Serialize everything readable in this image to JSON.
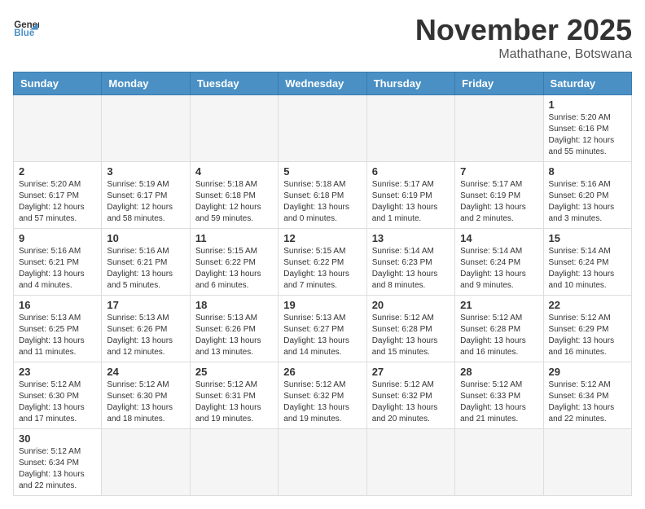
{
  "header": {
    "logo_general": "General",
    "logo_blue": "Blue",
    "month_title": "November 2025",
    "location": "Mathathane, Botswana"
  },
  "days_of_week": [
    "Sunday",
    "Monday",
    "Tuesday",
    "Wednesday",
    "Thursday",
    "Friday",
    "Saturday"
  ],
  "weeks": [
    [
      {
        "day": "",
        "info": ""
      },
      {
        "day": "",
        "info": ""
      },
      {
        "day": "",
        "info": ""
      },
      {
        "day": "",
        "info": ""
      },
      {
        "day": "",
        "info": ""
      },
      {
        "day": "",
        "info": ""
      },
      {
        "day": "1",
        "info": "Sunrise: 5:20 AM\nSunset: 6:16 PM\nDaylight: 12 hours and 55 minutes."
      }
    ],
    [
      {
        "day": "2",
        "info": "Sunrise: 5:20 AM\nSunset: 6:17 PM\nDaylight: 12 hours and 57 minutes."
      },
      {
        "day": "3",
        "info": "Sunrise: 5:19 AM\nSunset: 6:17 PM\nDaylight: 12 hours and 58 minutes."
      },
      {
        "day": "4",
        "info": "Sunrise: 5:18 AM\nSunset: 6:18 PM\nDaylight: 12 hours and 59 minutes."
      },
      {
        "day": "5",
        "info": "Sunrise: 5:18 AM\nSunset: 6:18 PM\nDaylight: 13 hours and 0 minutes."
      },
      {
        "day": "6",
        "info": "Sunrise: 5:17 AM\nSunset: 6:19 PM\nDaylight: 13 hours and 1 minute."
      },
      {
        "day": "7",
        "info": "Sunrise: 5:17 AM\nSunset: 6:19 PM\nDaylight: 13 hours and 2 minutes."
      },
      {
        "day": "8",
        "info": "Sunrise: 5:16 AM\nSunset: 6:20 PM\nDaylight: 13 hours and 3 minutes."
      }
    ],
    [
      {
        "day": "9",
        "info": "Sunrise: 5:16 AM\nSunset: 6:21 PM\nDaylight: 13 hours and 4 minutes."
      },
      {
        "day": "10",
        "info": "Sunrise: 5:16 AM\nSunset: 6:21 PM\nDaylight: 13 hours and 5 minutes."
      },
      {
        "day": "11",
        "info": "Sunrise: 5:15 AM\nSunset: 6:22 PM\nDaylight: 13 hours and 6 minutes."
      },
      {
        "day": "12",
        "info": "Sunrise: 5:15 AM\nSunset: 6:22 PM\nDaylight: 13 hours and 7 minutes."
      },
      {
        "day": "13",
        "info": "Sunrise: 5:14 AM\nSunset: 6:23 PM\nDaylight: 13 hours and 8 minutes."
      },
      {
        "day": "14",
        "info": "Sunrise: 5:14 AM\nSunset: 6:24 PM\nDaylight: 13 hours and 9 minutes."
      },
      {
        "day": "15",
        "info": "Sunrise: 5:14 AM\nSunset: 6:24 PM\nDaylight: 13 hours and 10 minutes."
      }
    ],
    [
      {
        "day": "16",
        "info": "Sunrise: 5:13 AM\nSunset: 6:25 PM\nDaylight: 13 hours and 11 minutes."
      },
      {
        "day": "17",
        "info": "Sunrise: 5:13 AM\nSunset: 6:26 PM\nDaylight: 13 hours and 12 minutes."
      },
      {
        "day": "18",
        "info": "Sunrise: 5:13 AM\nSunset: 6:26 PM\nDaylight: 13 hours and 13 minutes."
      },
      {
        "day": "19",
        "info": "Sunrise: 5:13 AM\nSunset: 6:27 PM\nDaylight: 13 hours and 14 minutes."
      },
      {
        "day": "20",
        "info": "Sunrise: 5:12 AM\nSunset: 6:28 PM\nDaylight: 13 hours and 15 minutes."
      },
      {
        "day": "21",
        "info": "Sunrise: 5:12 AM\nSunset: 6:28 PM\nDaylight: 13 hours and 16 minutes."
      },
      {
        "day": "22",
        "info": "Sunrise: 5:12 AM\nSunset: 6:29 PM\nDaylight: 13 hours and 16 minutes."
      }
    ],
    [
      {
        "day": "23",
        "info": "Sunrise: 5:12 AM\nSunset: 6:30 PM\nDaylight: 13 hours and 17 minutes."
      },
      {
        "day": "24",
        "info": "Sunrise: 5:12 AM\nSunset: 6:30 PM\nDaylight: 13 hours and 18 minutes."
      },
      {
        "day": "25",
        "info": "Sunrise: 5:12 AM\nSunset: 6:31 PM\nDaylight: 13 hours and 19 minutes."
      },
      {
        "day": "26",
        "info": "Sunrise: 5:12 AM\nSunset: 6:32 PM\nDaylight: 13 hours and 19 minutes."
      },
      {
        "day": "27",
        "info": "Sunrise: 5:12 AM\nSunset: 6:32 PM\nDaylight: 13 hours and 20 minutes."
      },
      {
        "day": "28",
        "info": "Sunrise: 5:12 AM\nSunset: 6:33 PM\nDaylight: 13 hours and 21 minutes."
      },
      {
        "day": "29",
        "info": "Sunrise: 5:12 AM\nSunset: 6:34 PM\nDaylight: 13 hours and 22 minutes."
      }
    ],
    [
      {
        "day": "30",
        "info": "Sunrise: 5:12 AM\nSunset: 6:34 PM\nDaylight: 13 hours and 22 minutes."
      },
      {
        "day": "",
        "info": ""
      },
      {
        "day": "",
        "info": ""
      },
      {
        "day": "",
        "info": ""
      },
      {
        "day": "",
        "info": ""
      },
      {
        "day": "",
        "info": ""
      },
      {
        "day": "",
        "info": ""
      }
    ]
  ]
}
